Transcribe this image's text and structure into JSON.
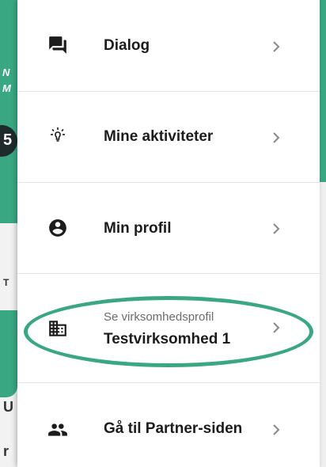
{
  "background": {
    "fragment_1": "N",
    "fragment_2": "M",
    "fragment_3": "5",
    "fragment_4": "T",
    "fragment_5": "U",
    "fragment_6": "r"
  },
  "menu": {
    "items": [
      {
        "label": "Dialog",
        "icon": "chat-icon"
      },
      {
        "label": "Mine aktiviteter",
        "icon": "lightbulb-icon"
      },
      {
        "label": "Min profil",
        "icon": "account-circle-icon"
      },
      {
        "sublabel": "Se virksomhedsprofil",
        "label": "Testvirksomhed 1",
        "icon": "business-icon"
      },
      {
        "label": "Gå til Partner-siden",
        "icon": "people-icon"
      }
    ]
  },
  "colors": {
    "accent": "#3aa783",
    "text": "#1c1c1c",
    "muted": "#6b6b6b",
    "divider": "#e3e3e3"
  }
}
